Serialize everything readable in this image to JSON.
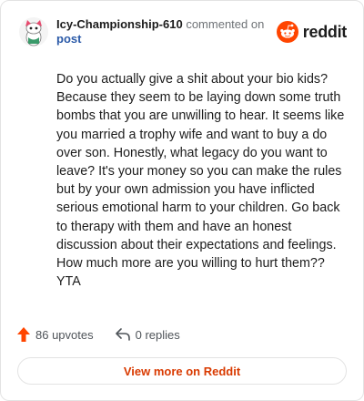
{
  "header": {
    "author": "Icy-Championship-610",
    "action_text": "commented on",
    "post_link": "post",
    "logo_text": "reddit",
    "avatar_icon": "snoo-avatar-icon",
    "logo_icon": "reddit-logo-icon"
  },
  "comment": {
    "text": "Do you actually give a shit about your bio kids? Because they seem to be laying down some truth bombs that you are unwilling to hear. It seems like you married a trophy wife and want to buy a do over son. Honestly, what legacy do you want to leave? It's your money so you can make the rules but by your own admission you have inflicted serious emotional harm to your children. Go back to therapy with them and have an honest discussion about their expectations and feelings. How much more are you willing to hurt them?? YTA"
  },
  "footer": {
    "upvotes_label": "86 upvotes",
    "replies_label": "0 replies",
    "upvote_icon": "upvote-arrow-icon",
    "reply_icon": "reply-arrow-icon"
  },
  "actions": {
    "view_more_label": "View more on Reddit"
  },
  "colors": {
    "accent": "#d93a00",
    "upvote": "#ff4500",
    "link": "#2b5aa8"
  }
}
